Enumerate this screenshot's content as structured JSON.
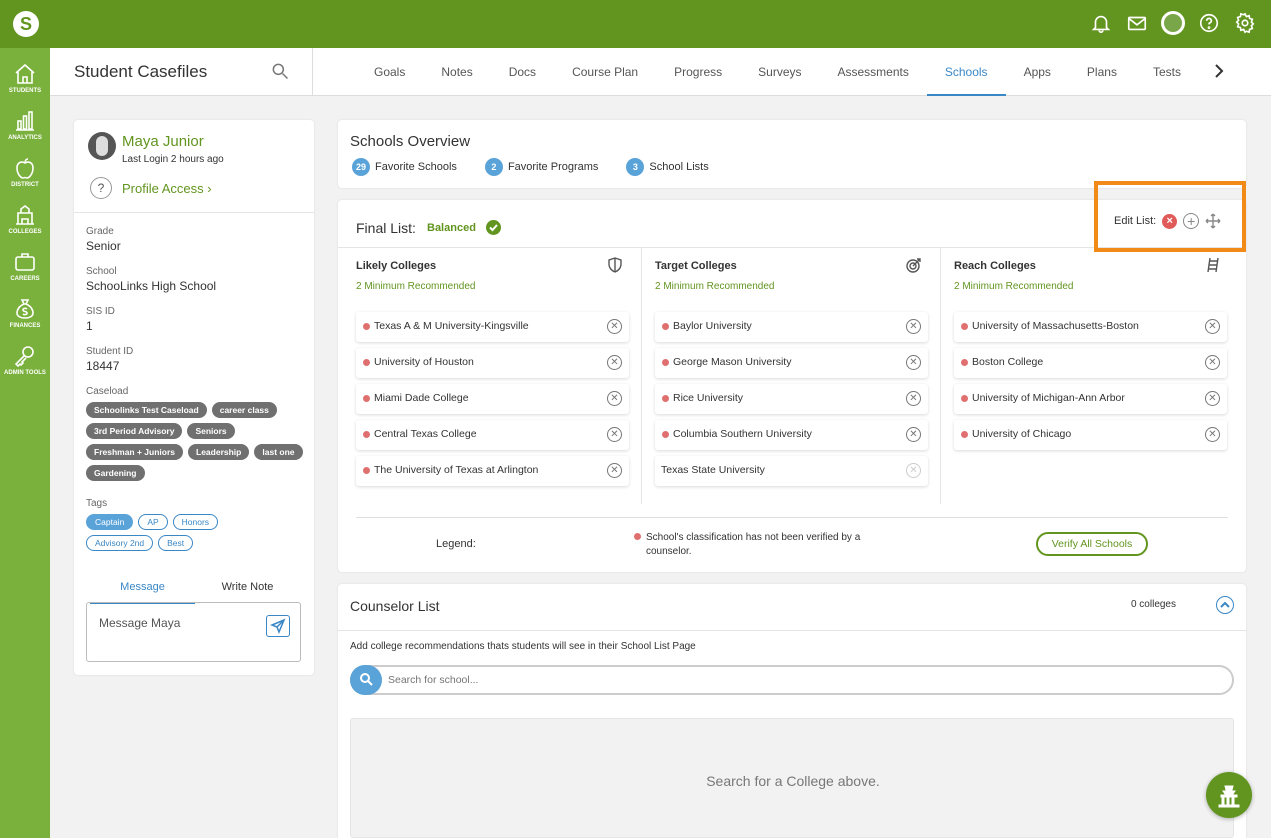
{
  "leftnav": [
    {
      "label": "STUDENTS",
      "icon": "home-icon"
    },
    {
      "label": "ANALYTICS",
      "icon": "bar-chart-icon"
    },
    {
      "label": "DISTRICT",
      "icon": "apple-icon"
    },
    {
      "label": "COLLEGES",
      "icon": "college-building-icon"
    },
    {
      "label": "CAREERS",
      "icon": "briefcase-icon"
    },
    {
      "label": "FINANCES",
      "icon": "money-bag-icon"
    },
    {
      "label": "ADMIN TOOLS",
      "icon": "key-icon"
    }
  ],
  "header": {
    "title": "Student Casefiles",
    "tabs": [
      "Goals",
      "Notes",
      "Docs",
      "Course Plan",
      "Progress",
      "Surveys",
      "Assessments",
      "Schools",
      "Apps",
      "Plans",
      "Tests"
    ],
    "active_tab": "Schools"
  },
  "profile": {
    "name": "Maya Junior",
    "last_login": "Last Login 2 hours ago",
    "profile_access": "Profile Access ›",
    "grade_label": "Grade",
    "grade": "Senior",
    "school_label": "School",
    "school": "SchooLinks High School",
    "sis_label": "SIS ID",
    "sis_id": "1",
    "student_id_label": "Student ID",
    "student_id": "18447",
    "caseload_label": "Caseload",
    "caseload": [
      "Schoolinks Test Caseload",
      "career class",
      "3rd Period Advisory",
      "Seniors",
      "Freshman + Juniors",
      "Leadership",
      "last one",
      "Gardening"
    ],
    "tags_label": "Tags",
    "tags": [
      "Captain",
      "AP",
      "Honors",
      "Advisory 2nd",
      "Best"
    ],
    "message_tab": "Message",
    "note_tab": "Write Note",
    "message_placeholder": "Message Maya"
  },
  "overview": {
    "title": "Schools Overview",
    "stats": [
      {
        "count": "29",
        "label": "Favorite Schools"
      },
      {
        "count": "2",
        "label": "Favorite Programs"
      },
      {
        "count": "3",
        "label": "School Lists"
      }
    ]
  },
  "final_list": {
    "title": "Final List:",
    "status": "Balanced",
    "edit_label": "Edit List:",
    "columns": [
      {
        "title": "Likely Colleges",
        "icon": "shield-icon",
        "min": "2 Minimum Recommended",
        "colleges": [
          {
            "name": "Texas A & M University-Kingsville",
            "unverified": true
          },
          {
            "name": "University of Houston",
            "unverified": true
          },
          {
            "name": "Miami Dade College",
            "unverified": true
          },
          {
            "name": "Central Texas College",
            "unverified": true
          },
          {
            "name": "The University of Texas at Arlington",
            "unverified": true
          }
        ]
      },
      {
        "title": "Target Colleges",
        "icon": "target-icon",
        "min": "2 Minimum Recommended",
        "colleges": [
          {
            "name": "Baylor University",
            "unverified": true
          },
          {
            "name": "George Mason University",
            "unverified": true
          },
          {
            "name": "Rice University",
            "unverified": true
          },
          {
            "name": "Columbia Southern University",
            "unverified": true
          },
          {
            "name": "Texas State University",
            "unverified": false
          }
        ]
      },
      {
        "title": "Reach Colleges",
        "icon": "ladder-icon",
        "min": "2 Minimum Recommended",
        "colleges": [
          {
            "name": "University of Massachusetts-Boston",
            "unverified": true
          },
          {
            "name": "Boston College",
            "unverified": true
          },
          {
            "name": "University of Michigan-Ann Arbor",
            "unverified": true
          },
          {
            "name": "University of Chicago",
            "unverified": true
          }
        ]
      }
    ],
    "legend_label": "Legend:",
    "legend_text": "School's classification has not been verified by a counselor.",
    "verify_button": "Verify All Schools"
  },
  "counselor": {
    "title": "Counselor List",
    "count": "0 colleges",
    "description": "Add college recommendations thats students will see in their School List Page",
    "search_placeholder": "Search for school...",
    "empty_text": "Search for a College above."
  },
  "colors": {
    "brand_green": "#62951f",
    "nav_green": "#7ab03c",
    "accent_blue": "#3a87c6",
    "unverified_red": "#e07070",
    "highlight_orange": "#f28a17"
  }
}
